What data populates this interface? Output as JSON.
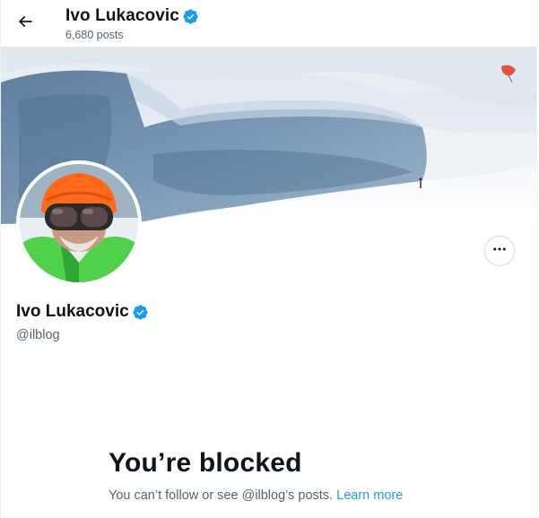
{
  "header": {
    "back_icon": "arrow-left-icon",
    "name": "Ivo Lukacovic",
    "verified_icon": "verified-badge-icon",
    "posts_count": "6,680 posts"
  },
  "profile": {
    "banner": "snowy-mountain-crevasse-photo",
    "avatar": "profile-photo-skier-helmet-goggles",
    "more_icon": "more-options-icon",
    "name": "Ivo Lukacovic",
    "handle": "@ilblog"
  },
  "blocked": {
    "title": "You’re blocked",
    "description": "You can’t follow or see @ilblog’s posts.",
    "learn_more": "Learn more"
  },
  "colors": {
    "verified_blue": "#1d9bf0",
    "link_blue": "#1d9bf0",
    "secondary_text": "#536471",
    "primary_text": "#0f1419"
  }
}
